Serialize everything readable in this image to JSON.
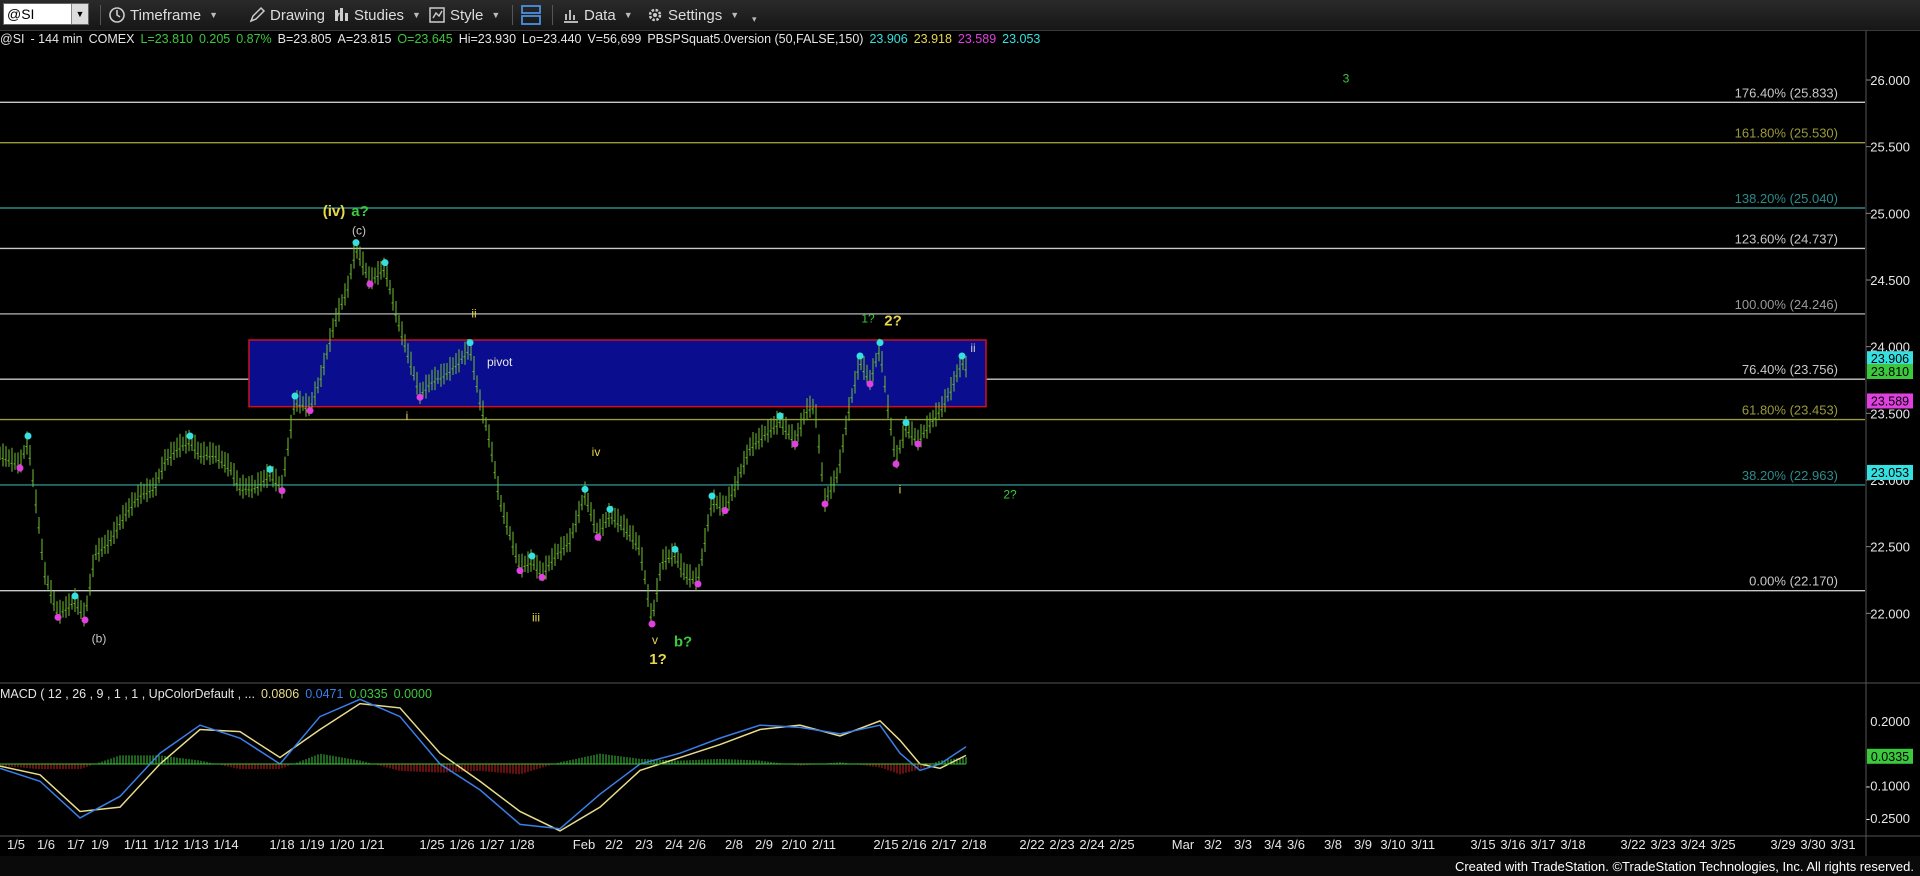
{
  "toolbar": {
    "symbol": "@SI",
    "timeframe_label": "Timeframe",
    "drawing_label": "Drawing",
    "studies_label": "Studies",
    "style_label": "Style",
    "data_label": "Data",
    "settings_label": "Settings"
  },
  "header": {
    "symbol": "@SI",
    "interval": "- 144 min",
    "exchange": "COMEX",
    "last": "L=23.810",
    "change": "0.205",
    "change_pct": "0.87%",
    "bid": "B=23.805",
    "ask": "A=23.815",
    "open": "O=23.645",
    "high": "Hi=23.930",
    "low": "Lo=23.440",
    "volume": "V=56,699",
    "study": "PBSPSquat5.0version (50,FALSE,150)",
    "study_values": [
      "23.906",
      "23.918",
      "23.589",
      "23.053"
    ]
  },
  "macd": {
    "label": "MACD ( 12 , 26 , 9 , 1 , 1 , UpColorDefault , ...",
    "values": [
      "0.0806",
      "0.0471",
      "0.0335",
      "0.0000"
    ],
    "last_badge": "0.0335"
  },
  "footer": "Created with TradeStation. ©TradeStation Technologies, Inc. All rights reserved.",
  "colors": {
    "background": "#000000",
    "bar": "#6fbf2f",
    "pivot_fill": "#0b0d8f",
    "pivot_border": "#d01020",
    "cyan": "#36e0e0",
    "magenta": "#e040e0",
    "yellow": "#e8d84a",
    "green": "#3cc83c",
    "macd_line": "#3a7ee8",
    "signal_line": "#e8dc8a"
  },
  "chart_data": {
    "type": "ohlc",
    "instrument": "@SI",
    "ylim": [
      21.5,
      26.3
    ],
    "y_ticks": [
      22.0,
      22.5,
      23.0,
      23.5,
      24.0,
      24.5,
      25.0,
      25.5,
      26.0
    ],
    "y_tick_labels": [
      "22.000",
      "22.500",
      "23.000",
      "23.500",
      "24.000",
      "24.500",
      "25.000",
      "25.500",
      "26.000"
    ],
    "x_tick_labels": [
      "1/5",
      "1/6",
      "1/7",
      "1/9",
      "1/11",
      "1/12",
      "1/13",
      "1/14",
      "1/18",
      "1/19",
      "1/20",
      "1/21",
      "1/25",
      "1/26",
      "1/27",
      "1/28",
      "Feb",
      "2/2",
      "2/3",
      "2/4",
      "2/6",
      "2/8",
      "2/9",
      "2/10",
      "2/11",
      "2/15",
      "2/16",
      "2/17",
      "2/18",
      "2/22",
      "2/23",
      "2/24",
      "2/25",
      "Mar",
      "3/2",
      "3/3",
      "3/4",
      "3/6",
      "3/8",
      "3/9",
      "3/10",
      "3/11",
      "3/15",
      "3/16",
      "3/17",
      "3/18",
      "3/22",
      "3/23",
      "3/24",
      "3/25",
      "3/29",
      "3/30",
      "3/31"
    ],
    "price_path": [
      [
        0,
        23.2
      ],
      [
        20,
        23.12
      ],
      [
        28,
        23.3
      ],
      [
        35,
        22.9
      ],
      [
        45,
        22.3
      ],
      [
        58,
        22.0
      ],
      [
        75,
        22.1
      ],
      [
        85,
        21.98
      ],
      [
        95,
        22.45
      ],
      [
        110,
        22.55
      ],
      [
        125,
        22.75
      ],
      [
        140,
        22.9
      ],
      [
        155,
        22.95
      ],
      [
        165,
        23.15
      ],
      [
        178,
        23.25
      ],
      [
        190,
        23.3
      ],
      [
        200,
        23.2
      ],
      [
        215,
        23.2
      ],
      [
        230,
        23.1
      ],
      [
        240,
        22.95
      ],
      [
        255,
        22.95
      ],
      [
        270,
        23.05
      ],
      [
        282,
        22.95
      ],
      [
        295,
        23.6
      ],
      [
        310,
        23.55
      ],
      [
        320,
        23.75
      ],
      [
        335,
        24.2
      ],
      [
        348,
        24.45
      ],
      [
        356,
        24.75
      ],
      [
        370,
        24.5
      ],
      [
        385,
        24.6
      ],
      [
        398,
        24.2
      ],
      [
        410,
        23.9
      ],
      [
        420,
        23.65
      ],
      [
        432,
        23.75
      ],
      [
        445,
        23.8
      ],
      [
        460,
        23.9
      ],
      [
        470,
        24.0
      ],
      [
        480,
        23.6
      ],
      [
        490,
        23.3
      ],
      [
        500,
        22.85
      ],
      [
        510,
        22.6
      ],
      [
        520,
        22.35
      ],
      [
        532,
        22.4
      ],
      [
        542,
        22.3
      ],
      [
        556,
        22.45
      ],
      [
        570,
        22.55
      ],
      [
        585,
        22.9
      ],
      [
        598,
        22.6
      ],
      [
        610,
        22.75
      ],
      [
        625,
        22.65
      ],
      [
        640,
        22.5
      ],
      [
        652,
        21.95
      ],
      [
        662,
        22.4
      ],
      [
        675,
        22.45
      ],
      [
        685,
        22.3
      ],
      [
        698,
        22.25
      ],
      [
        712,
        22.85
      ],
      [
        725,
        22.8
      ],
      [
        735,
        22.95
      ],
      [
        750,
        23.25
      ],
      [
        765,
        23.35
      ],
      [
        780,
        23.45
      ],
      [
        795,
        23.3
      ],
      [
        808,
        23.55
      ],
      [
        815,
        23.55
      ],
      [
        825,
        22.85
      ],
      [
        838,
        23.05
      ],
      [
        848,
        23.5
      ],
      [
        860,
        23.9
      ],
      [
        870,
        23.75
      ],
      [
        880,
        24.0
      ],
      [
        888,
        23.55
      ],
      [
        896,
        23.15
      ],
      [
        906,
        23.4
      ],
      [
        918,
        23.3
      ],
      [
        932,
        23.45
      ],
      [
        942,
        23.55
      ],
      [
        952,
        23.7
      ],
      [
        962,
        23.9
      ],
      [
        966,
        23.85
      ]
    ],
    "price_badges": [
      {
        "value": 23.906,
        "label": "23.906",
        "color": "#36e0e0"
      },
      {
        "value": 23.81,
        "label": "23.810",
        "color": "#3cc83c"
      },
      {
        "value": 23.589,
        "label": "23.589",
        "color": "#e040e0"
      },
      {
        "value": 23.053,
        "label": "23.053",
        "color": "#36e0e0"
      }
    ],
    "fib_levels": [
      {
        "label": "176.40% (25.833)",
        "value": 25.833,
        "color": "#c8c8c8"
      },
      {
        "label": "161.80% (25.530)",
        "value": 25.53,
        "color": "#9a9a3a"
      },
      {
        "label": "138.20% (25.040)",
        "value": 25.04,
        "color": "#2e8b8b"
      },
      {
        "label": "123.60% (24.737)",
        "value": 24.737,
        "color": "#c8c8c8"
      },
      {
        "label": "100.00% (24.246)",
        "value": 24.246,
        "color": "#9a9a9a"
      },
      {
        "label": "76.40% (23.756)",
        "value": 23.756,
        "color": "#c8c8c8"
      },
      {
        "label": "61.80% (23.453)",
        "value": 23.453,
        "color": "#9a9a3a"
      },
      {
        "label": "38.20% (22.963)",
        "value": 22.963,
        "color": "#2e8b8b"
      },
      {
        "label": "0.00% (22.170)",
        "value": 22.17,
        "color": "#c8c8c8"
      }
    ],
    "pivot_zone": {
      "label": "pivot",
      "top": 24.05,
      "bottom": 23.55
    },
    "annotations": [
      {
        "text": "3",
        "value": 25.98,
        "color": "#3cc83c"
      },
      {
        "text": "(iv)",
        "value": 24.98,
        "color": "#e8d84a"
      },
      {
        "text": "a?",
        "value": 24.98,
        "color": "#3cc83c"
      },
      {
        "text": "(c)",
        "value": 24.84,
        "color": "#c8c8c8"
      },
      {
        "text": "ii",
        "value": 24.22,
        "color": "#e8d84a"
      },
      {
        "text": "1?",
        "value": 24.18,
        "color": "#3cc83c"
      },
      {
        "text": "2?",
        "value": 24.16,
        "color": "#e8d84a"
      },
      {
        "text": "ii",
        "value": 23.96,
        "color": "#c8c8c8"
      },
      {
        "text": "i",
        "value": 23.45,
        "color": "#e8d84a"
      },
      {
        "text": "iv",
        "value": 23.18,
        "color": "#e8d84a"
      },
      {
        "text": "i",
        "value": 22.9,
        "color": "#e8d84a"
      },
      {
        "text": "2?",
        "value": 22.86,
        "color": "#3cc83c"
      },
      {
        "text": "iii",
        "value": 21.94,
        "color": "#e8d84a"
      },
      {
        "text": "(b)",
        "value": 21.78,
        "color": "#c8c8c8"
      },
      {
        "text": "v",
        "value": 21.77,
        "color": "#e8d84a"
      },
      {
        "text": "b?",
        "value": 21.75,
        "color": "#3cc83c"
      },
      {
        "text": "1?",
        "value": 21.62,
        "color": "#e8d84a"
      }
    ],
    "macd": {
      "ylim": [
        -0.32,
        0.32
      ],
      "y_ticks": [
        0.2,
        -0.1,
        -0.25
      ],
      "y_tick_labels": [
        "0.2000",
        "-0.1000",
        "-0.2500"
      ],
      "macd_path": [
        [
          0,
          -0.02
        ],
        [
          40,
          -0.08
        ],
        [
          80,
          -0.25
        ],
        [
          120,
          -0.15
        ],
        [
          160,
          0.05
        ],
        [
          200,
          0.18
        ],
        [
          240,
          0.12
        ],
        [
          280,
          0.0
        ],
        [
          320,
          0.22
        ],
        [
          360,
          0.3
        ],
        [
          400,
          0.22
        ],
        [
          440,
          0.0
        ],
        [
          480,
          -0.12
        ],
        [
          520,
          -0.28
        ],
        [
          560,
          -0.3
        ],
        [
          600,
          -0.14
        ],
        [
          640,
          0.0
        ],
        [
          680,
          0.05
        ],
        [
          720,
          0.12
        ],
        [
          760,
          0.18
        ],
        [
          800,
          0.17
        ],
        [
          840,
          0.14
        ],
        [
          880,
          0.18
        ],
        [
          900,
          0.05
        ],
        [
          920,
          -0.03
        ],
        [
          940,
          0.0
        ],
        [
          966,
          0.08
        ]
      ],
      "signal_path": [
        [
          0,
          -0.01
        ],
        [
          40,
          -0.05
        ],
        [
          80,
          -0.22
        ],
        [
          120,
          -0.2
        ],
        [
          160,
          0.0
        ],
        [
          200,
          0.16
        ],
        [
          240,
          0.15
        ],
        [
          280,
          0.03
        ],
        [
          320,
          0.16
        ],
        [
          360,
          0.28
        ],
        [
          400,
          0.26
        ],
        [
          440,
          0.05
        ],
        [
          480,
          -0.08
        ],
        [
          520,
          -0.22
        ],
        [
          560,
          -0.31
        ],
        [
          600,
          -0.2
        ],
        [
          640,
          -0.03
        ],
        [
          680,
          0.03
        ],
        [
          720,
          0.09
        ],
        [
          760,
          0.16
        ],
        [
          800,
          0.18
        ],
        [
          840,
          0.13
        ],
        [
          880,
          0.2
        ],
        [
          900,
          0.11
        ],
        [
          920,
          0.0
        ],
        [
          940,
          -0.02
        ],
        [
          966,
          0.04
        ]
      ]
    }
  }
}
